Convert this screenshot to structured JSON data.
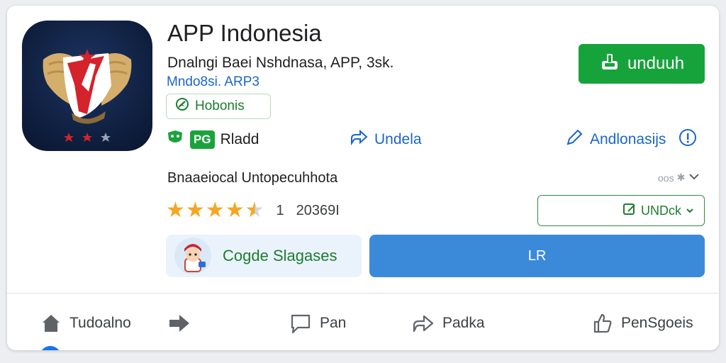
{
  "app": {
    "title": "APP Indonesia",
    "subtitle": "Dnalngi Baei Nshdnasa, APP, 3sk.",
    "developer": "Mndo8si. ARP3",
    "chip_label": "Hobonis"
  },
  "install_button": {
    "label": "unduuh",
    "color": "#17a33b"
  },
  "info_row": {
    "rating_badge": "PG",
    "rating_badge_suffix": "Rladd",
    "share_label": "Undela",
    "android_label": "Andlonasijs"
  },
  "section": {
    "title": "Bnaaeiocal Untopecuhhota",
    "more_label": "oos"
  },
  "rating": {
    "stars_filled": 4.5,
    "stars_max": 5,
    "value": "1",
    "count": "20369I"
  },
  "dropdown": {
    "label": "UNDck"
  },
  "promo": {
    "label": "Cogde Slagases"
  },
  "primary_button": {
    "label": "LR",
    "color": "#3b8ad9"
  },
  "bottom_nav": [
    {
      "label": "Tudoalno",
      "icon": "home-icon"
    },
    {
      "label": "",
      "icon": "arrow-right-icon"
    },
    {
      "label": "Pan",
      "icon": "chat-bubble-icon"
    },
    {
      "label": "Padka",
      "icon": "share-icon"
    },
    {
      "label": "PenSgoeis",
      "icon": "thumbs-up-icon"
    }
  ],
  "colors": {
    "accent_green": "#17a33b",
    "link_blue": "#1a66c9",
    "star_gold": "#f5a623",
    "primary_blue": "#3b8ad9"
  }
}
